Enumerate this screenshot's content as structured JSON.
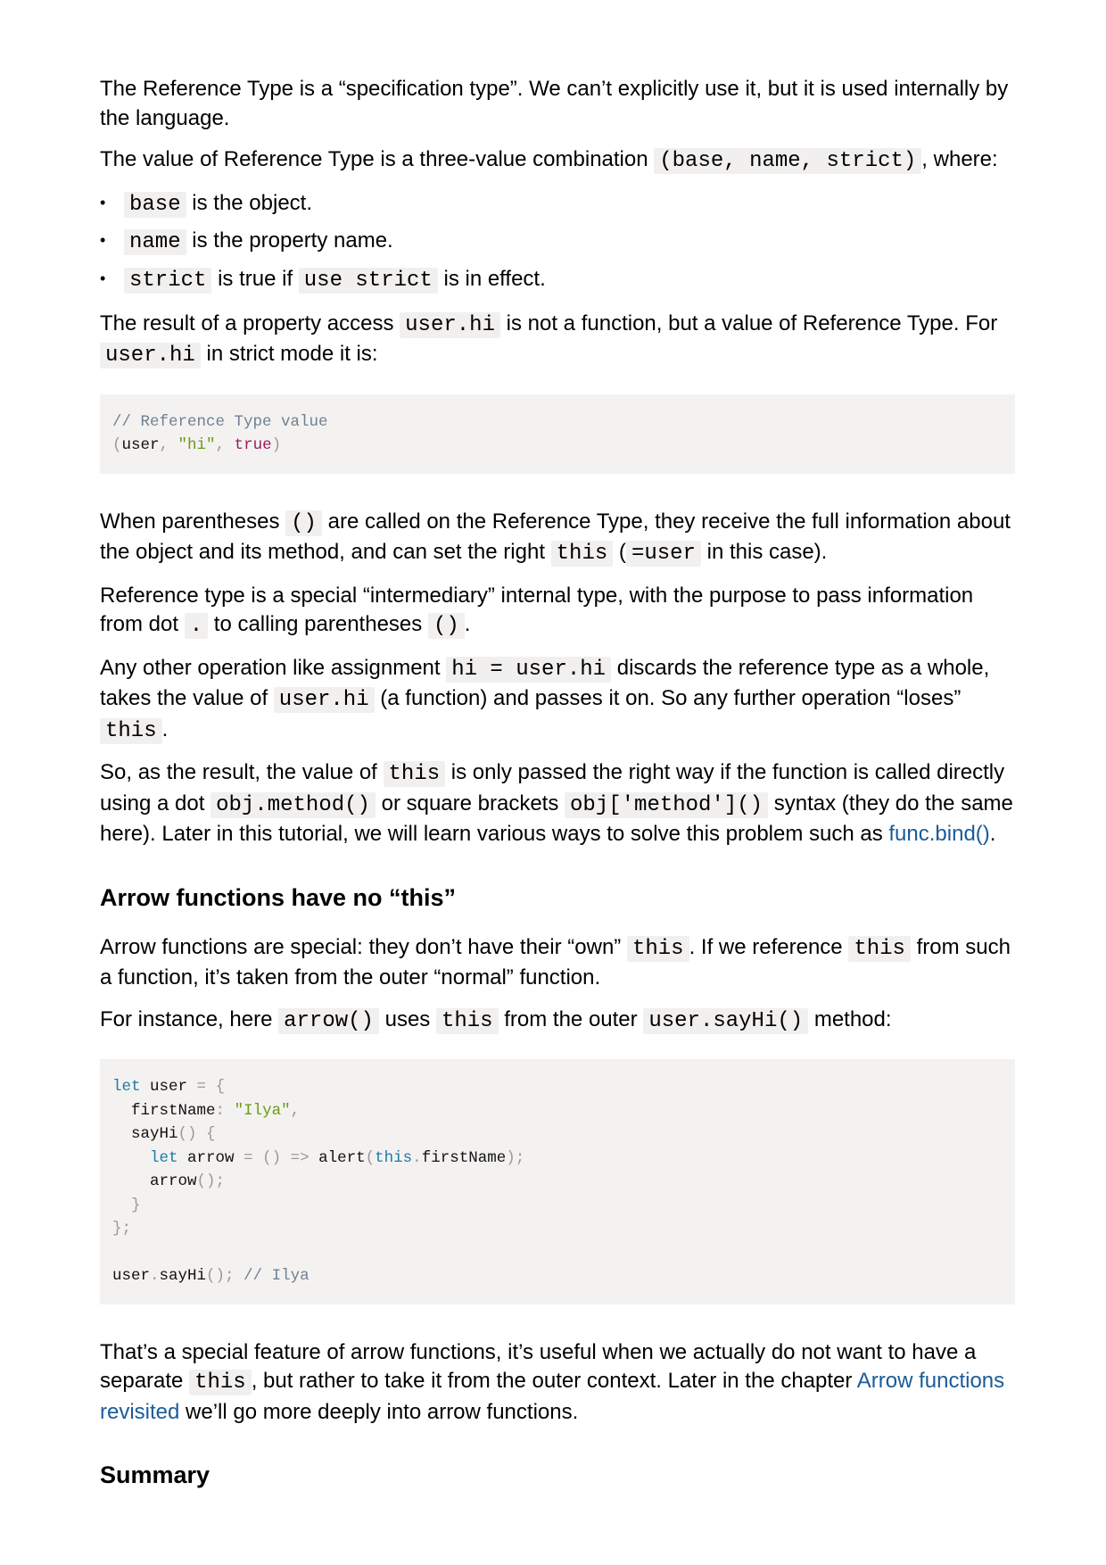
{
  "ref_intro": {
    "p1": "The Reference Type is a “specification type”. We can’t explicitly use it, but it is used internally by the language.",
    "p2_before": "The value of Reference Type is a three-value combination ",
    "p2_code": "(base, name, strict)",
    "p2_after": ", where:"
  },
  "bullets": [
    {
      "code": "base",
      "text": " is the object."
    },
    {
      "code": "name",
      "text": " is the property name."
    },
    {
      "code": "strict",
      "text": " is true if ",
      "code2": "use strict",
      "text2": " is in effect."
    }
  ],
  "property_access": {
    "before": "The result of a property access ",
    "code1": "user.hi",
    "middle": " is not a function, but a value of Reference Type. For ",
    "code2": "user.hi",
    "after": " in strict mode it is:"
  },
  "code1": {
    "comment": "// Reference Type value",
    "open": "(",
    "user": "user",
    "comma1": ", ",
    "hi": "\"hi\"",
    "comma2": ", ",
    "true": "true",
    "close": ")"
  },
  "parens_paragraph": {
    "t1": "When parentheses ",
    "c1": "()",
    "t2": " are called on the Reference Type, they receive the full information about the object and its method, and can set the right ",
    "c2": "this",
    "t3": " (",
    "c3": "=user",
    "t4": " in this case)."
  },
  "intermediary_paragraph": {
    "t1": "Reference type is a special “intermediary” internal type, with the purpose to pass information from dot ",
    "c1": ".",
    "t2": " to calling parentheses ",
    "c2": "()",
    "t3": "."
  },
  "assignment_paragraph": {
    "t1": "Any other operation like assignment ",
    "c1": "hi = user.hi",
    "t2": " discards the reference type as a whole, takes the value of ",
    "c2": "user.hi",
    "t3": " (a function) and passes it on. So any further operation “loses” ",
    "c3": "this",
    "t4": "."
  },
  "result_paragraph": {
    "t1": "So, as the result, the value of ",
    "c1": "this",
    "t2": " is only passed the right way if the function is called directly using a dot ",
    "c2": "obj.method()",
    "t3": " or square brackets ",
    "c3": "obj['method']()",
    "t4": " syntax (they do the same here). Later in this tutorial, we will learn various ways to solve this problem such as ",
    "link": "func.bind()",
    "t5": "."
  },
  "arrow_section": {
    "heading": "Arrow functions have no “this”",
    "p1_t1": "Arrow functions are special: they don’t have their “own” ",
    "p1_c1": "this",
    "p1_t2": ". If we reference ",
    "p1_c2": "this",
    "p1_t3": " from such a function, it’s taken from the outer “normal” function.",
    "p2_t1": "For instance, here ",
    "p2_c1": "arrow()",
    "p2_t2": " uses ",
    "p2_c2": "this",
    "p2_t3": " from the outer ",
    "p2_c3": "user.sayHi()",
    "p2_t4": " method:"
  },
  "code2": {
    "let1": "let",
    "user": " user ",
    "eq1": "=",
    "sp1": " ",
    "brace_open": "{",
    "firstName": "  firstName",
    "colon": ":",
    "sp2": " ",
    "ilya_str": "\"Ilya\"",
    "comma": ",",
    "sayHi": "  sayHi",
    "sayHi_parens": "()",
    "sp3": " ",
    "sayHi_brace": "{",
    "indent4": "    ",
    "let2": "let",
    "arrow": " arrow ",
    "eq2": "=",
    "sp4": " ",
    "arrow_parens": "()",
    "sp5": " ",
    "fat_arrow": "=>",
    "alert": " alert",
    "paren_open": "(",
    "this_kw": "this",
    "dot": ".",
    "firstName_prop": "firstName",
    "paren_close": ");",
    "arrow_call": "    arrow",
    "arrow_call_end": "();",
    "close_inner": "  }",
    "close_outer": "};",
    "call_user": "user",
    "call_dot": ".",
    "call_sayHi": "sayHi",
    "call_end": "();",
    "call_comment": " // Ilya"
  },
  "special_feature_paragraph": {
    "t1": "That’s a special feature of arrow functions, it’s useful when we actually do not want to have a separate ",
    "c1": "this",
    "t2": ", but rather to take it from the outer context. Later in the chapter ",
    "link": "Arrow functions revisited",
    "t3": " we’ll go more deeply into arrow functions."
  },
  "summary_heading": "Summary",
  "colors": {
    "link": "#1a5c99",
    "code_bg": "#f2f0ef",
    "comment": "#708090",
    "keyword": "#1c7aa6",
    "string": "#6a9a17",
    "boolean": "#961e5d"
  }
}
